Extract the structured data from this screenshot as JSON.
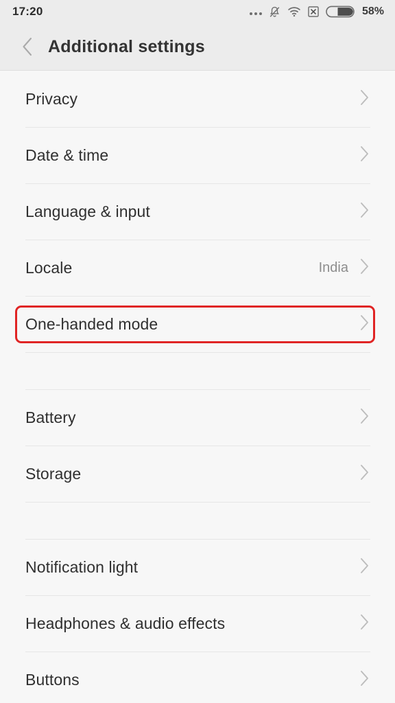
{
  "status_bar": {
    "time": "17:20",
    "battery_percent": "58%",
    "icons": [
      "more-dots-icon",
      "bell-muted-icon",
      "wifi-icon",
      "no-sim-icon",
      "battery-icon"
    ]
  },
  "app_bar": {
    "back_icon": "chevron-left-icon",
    "title": "Additional settings"
  },
  "colors": {
    "highlight": "#e02424",
    "background": "#f7f7f7",
    "bar_background": "#ececec",
    "label": "#303030",
    "value": "#8d8d8d"
  },
  "groups": [
    {
      "items": [
        {
          "label": "Privacy",
          "value": "",
          "chevron": true
        },
        {
          "label": "Date & time",
          "value": "",
          "chevron": true
        },
        {
          "label": "Language & input",
          "value": "",
          "chevron": true
        },
        {
          "label": "Locale",
          "value": "India",
          "chevron": true
        },
        {
          "label": "One-handed mode",
          "value": "",
          "chevron": true,
          "highlighted": true
        }
      ]
    },
    {
      "items": [
        {
          "label": "Battery",
          "value": "",
          "chevron": true
        },
        {
          "label": "Storage",
          "value": "",
          "chevron": true
        }
      ]
    },
    {
      "items": [
        {
          "label": "Notification light",
          "value": "",
          "chevron": true
        },
        {
          "label": "Headphones & audio effects",
          "value": "",
          "chevron": true
        },
        {
          "label": "Buttons",
          "value": "",
          "chevron": true
        }
      ]
    }
  ]
}
